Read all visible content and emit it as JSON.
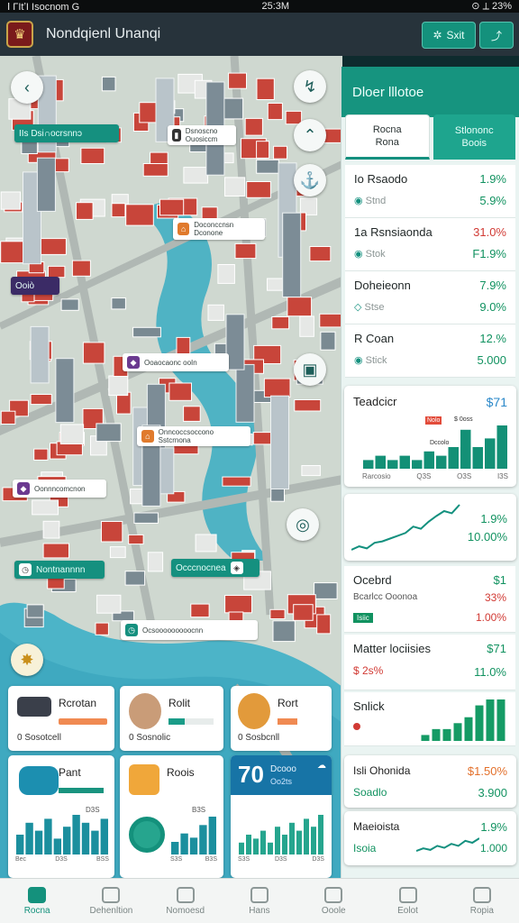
{
  "status": {
    "left": "Ⅰ ΓItʼI Isocnom  G",
    "time": "25:3M",
    "right": "⊙  ⟂ 23%"
  },
  "header": {
    "title": "Nondqienl Unanqi",
    "btn1": "Sxit",
    "btn1_icon": "✲",
    "btn2_icon": "⤴"
  },
  "map": {
    "labels": [
      {
        "text": "IIs Dsi∩ocrsnnɔ",
        "style": "teal"
      },
      {
        "text": "Dsnoscno Ouosiccm",
        "style": "white"
      },
      {
        "text": "Doconccnsn Dconone",
        "style": "white"
      },
      {
        "text": "Ooiò",
        "style": "teal"
      },
      {
        "text": "Ooaocaonc ooIn",
        "style": "white"
      },
      {
        "text": "Onncoccsoccono Sstcrnona",
        "style": "white"
      },
      {
        "text": "Oonnncomcnon",
        "style": "white"
      },
      {
        "text": "Nontnannnn",
        "style": "teal"
      },
      {
        "text": "Occcnocnea",
        "style": "teal"
      },
      {
        "text": "Ocsooooooooocnn",
        "style": "white"
      }
    ]
  },
  "panel": {
    "title": "Dloer lllotoe",
    "tabs": [
      {
        "label": "Rocna\nRona"
      },
      {
        "label": "Stlononc\nBoois"
      }
    ],
    "stocks": [
      {
        "name": "Io Rsaodo",
        "sub": "Stnd",
        "change": "1.9%",
        "price": "5.9%",
        "change_color": "green",
        "price_color": "green"
      },
      {
        "name": "1a Rsnsiaonda",
        "sub": "Stok",
        "change": "31.0%",
        "price": "F1.9%",
        "change_color": "red",
        "price_color": "green"
      },
      {
        "name": "Doheieonn",
        "sub": "Stse",
        "change": "7.9%",
        "price": "9.0%",
        "change_color": "green",
        "price_color": "green"
      },
      {
        "name": "R Coan",
        "sub": "Stick",
        "change": "12.%",
        "price": "5.000",
        "change_color": "green",
        "price_color": "green"
      }
    ],
    "chart1": {
      "title": "Teadcicr",
      "value": "$71",
      "tag1": "Nolo",
      "tag2": "$ 0oss",
      "tag3": "Dccolo",
      "xlabels": [
        "Rarcosio",
        "Q3S",
        "O3S",
        "I3S"
      ],
      "chart_data": {
        "type": "bar",
        "values": [
          2,
          3,
          2,
          3,
          2,
          4,
          3,
          5,
          9,
          5,
          7,
          10
        ]
      }
    },
    "chart2": {
      "v1": "1.9%",
      "v2": "10.00%",
      "chart_data": {
        "type": "line",
        "values": [
          3,
          3.5,
          3.2,
          4,
          4.2,
          4.6,
          5,
          5.4,
          6.3,
          6,
          7,
          7.8,
          8.5,
          8.2,
          9.4
        ]
      }
    },
    "c3": {
      "name": "Ocebrd",
      "value": "$1",
      "sub": "Bcarlcc Ooonoa",
      "pct": "33%",
      "tag": "Isiic",
      "pct2": "1.00%"
    },
    "c4": {
      "name": "Matter lociisies",
      "value": "$71",
      "sub": "$ 2s%",
      "pct": "11.0%"
    },
    "c5": {
      "name": "Snlick",
      "chart_data": {
        "type": "bar",
        "values": [
          1,
          2,
          2,
          3,
          4,
          6,
          7,
          7
        ]
      }
    },
    "c6": {
      "name": "Isli Ohonida",
      "value": "$1.50%",
      "sub": "Soadlo",
      "pct": "3.900"
    },
    "c7": {
      "name": "Maeioista",
      "value": "1.9%",
      "sub": "Isoia",
      "pct": "1.000",
      "chart_data": {
        "type": "line",
        "values": [
          2,
          2.5,
          2.2,
          3,
          2.6,
          3.4,
          3,
          4,
          3.6,
          4.5
        ]
      }
    }
  },
  "cards": {
    "r1": [
      {
        "title": "Rcrotan",
        "sub": "0 Sosotcell"
      },
      {
        "title": "Rolit",
        "sub": "0 Sosnolic"
      },
      {
        "title": "Rort",
        "sub": "0 Sosbcnll"
      }
    ],
    "r2": [
      {
        "title": "Pant",
        "top": "D3S",
        "xlabels": [
          "Bec",
          "D3S",
          "BSS"
        ],
        "chart_data": {
          "type": "bar",
          "values": [
            5,
            8,
            6,
            9,
            4,
            7,
            10,
            8,
            6,
            9
          ]
        }
      },
      {
        "title": "Roois",
        "top": "B3S",
        "xlabels": [
          "S3S",
          "B3S"
        ],
        "chart_data": {
          "type": "bar",
          "values": [
            3,
            5,
            4,
            7,
            9
          ]
        }
      },
      {
        "big": "70",
        "title": "Dcooo",
        "sub": "Oo2ts",
        "xlabels": [
          "S3S",
          "D3S",
          "D3S"
        ],
        "chart_data": {
          "type": "bar",
          "values": [
            3,
            5,
            4,
            6,
            3,
            7,
            5,
            8,
            6,
            9,
            7,
            10
          ]
        }
      }
    ]
  },
  "nav": [
    {
      "label": "Rocna",
      "active": true
    },
    {
      "label": "Dehenltion",
      "active": false
    },
    {
      "label": "Nomoesd",
      "active": false
    },
    {
      "label": "Hans",
      "active": false
    },
    {
      "label": "Ooole",
      "active": false
    },
    {
      "label": "Eolot",
      "active": false
    },
    {
      "label": "Ropia",
      "active": false
    }
  ]
}
